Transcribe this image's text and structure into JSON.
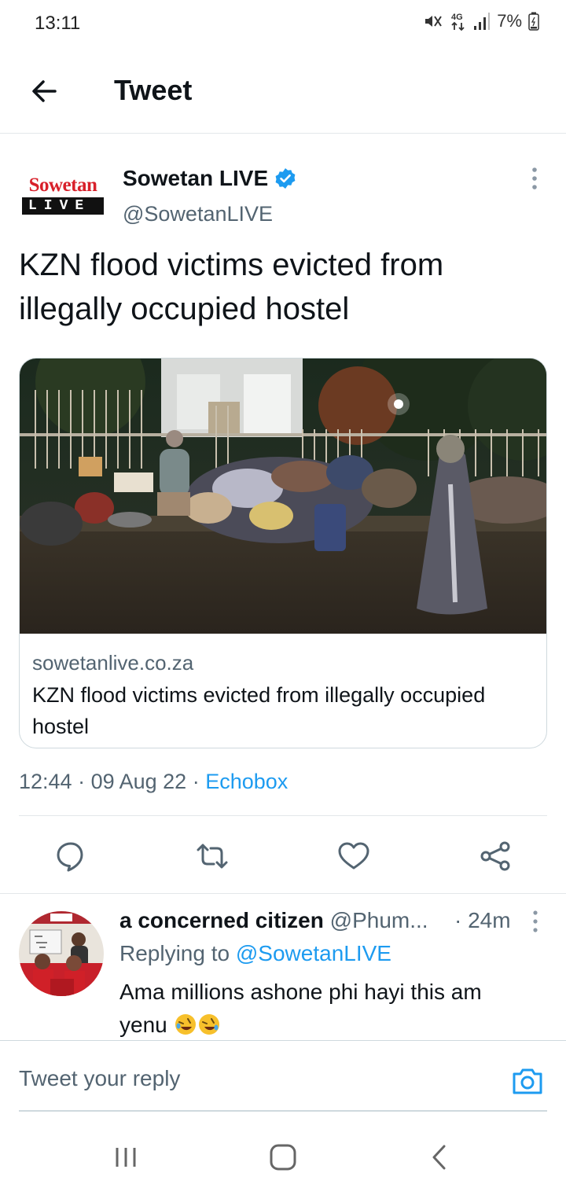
{
  "status_bar": {
    "time": "13:11",
    "network": "4G",
    "battery": "7%",
    "icons": [
      "mute-icon",
      "network-4g-icon",
      "signal-icon",
      "battery-icon"
    ]
  },
  "header": {
    "title": "Tweet",
    "back_icon": "arrow-left-icon"
  },
  "tweet": {
    "author": {
      "name": "Sowetan LIVE",
      "handle": "@SowetanLIVE",
      "verified": true,
      "avatar_logo_word": "Sowetan",
      "avatar_logo_sub": "LIVE"
    },
    "text": "KZN flood victims evicted from illegally occupied hostel",
    "card": {
      "domain": "sowetanlive.co.za",
      "title": "KZN flood victims evicted from illegally occupied hostel"
    },
    "meta": {
      "time": "12:44",
      "separator": " · ",
      "date": "09 Aug 22",
      "source": "Echobox"
    },
    "actions": [
      {
        "name": "reply",
        "icon": "reply-icon"
      },
      {
        "name": "retweet",
        "icon": "retweet-icon"
      },
      {
        "name": "like",
        "icon": "heart-icon"
      },
      {
        "name": "share",
        "icon": "share-icon"
      }
    ]
  },
  "reply": {
    "name": "a concerned citizen",
    "handle": "@Phum...",
    "time": "· 24m",
    "replying_prefix": "Replying to ",
    "replying_to": "@SowetanLIVE",
    "text": "Ama millions ashone phi hayi this am yenu"
  },
  "composer": {
    "placeholder": "Tweet your reply",
    "camera_icon": "camera-icon"
  },
  "colors": {
    "accent": "#1d9bf0",
    "text": "#0f1419",
    "secondary": "#536471",
    "divider": "#e3e7ea",
    "sowetan_red": "#d8202a"
  }
}
